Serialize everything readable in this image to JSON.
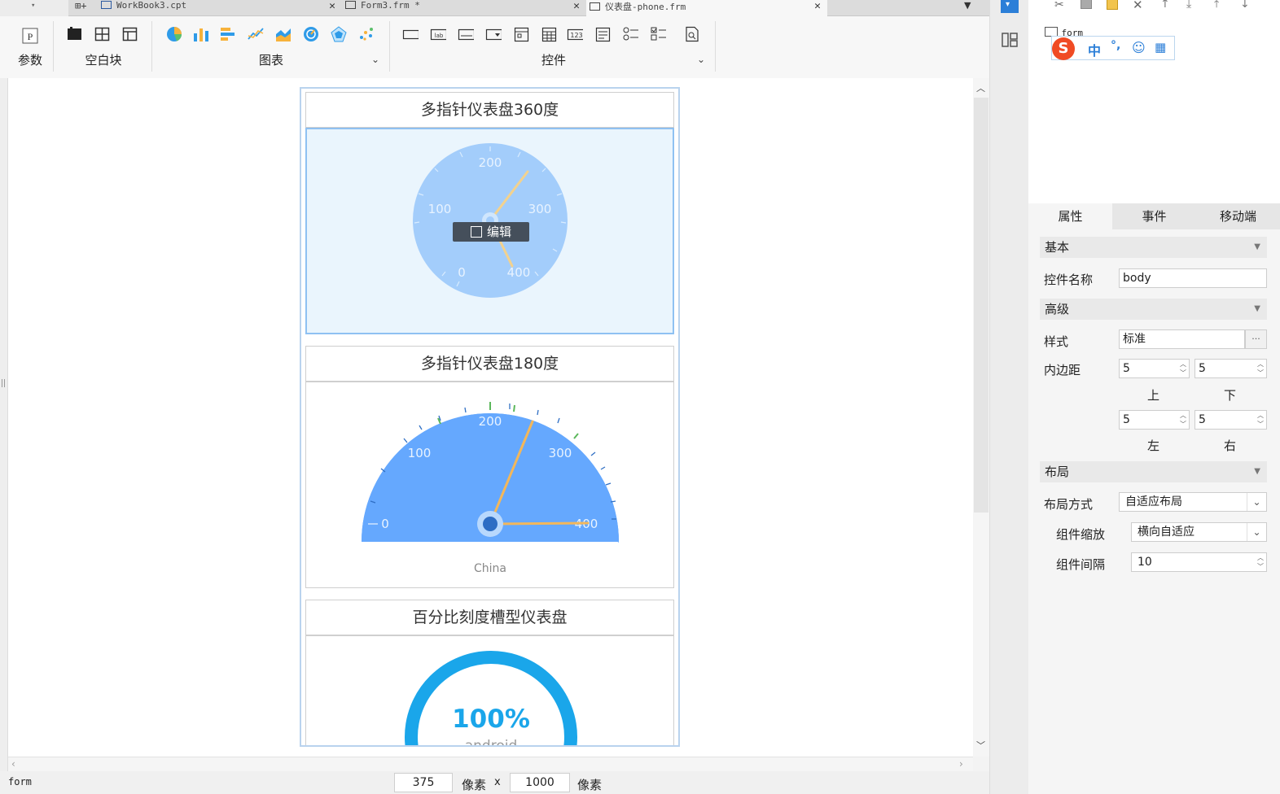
{
  "tabs": [
    {
      "label": "WorkBook3.cpt",
      "icon": "workbook-icon"
    },
    {
      "label": "Form3.frm *",
      "icon": "form-icon"
    },
    {
      "label": "仪表盘-phone.frm",
      "icon": "form-icon"
    }
  ],
  "toolbar": {
    "groups": [
      {
        "label": "参数"
      },
      {
        "label": "空白块"
      },
      {
        "label": "图表"
      },
      {
        "label": "控件"
      }
    ]
  },
  "canvas": {
    "widgets": [
      {
        "title": "多指针仪表盘360度",
        "ticks": [
          "200",
          "100",
          "300",
          "0",
          "400"
        ],
        "edit_label": "编辑"
      },
      {
        "title": "多指针仪表盘180度",
        "ticks": [
          "200",
          "100",
          "300",
          "0",
          "400"
        ],
        "footer": "China"
      },
      {
        "title": "百分比刻度槽型仪表盘",
        "value": "100%",
        "footer": "android"
      }
    ]
  },
  "statusbar": {
    "name": "form",
    "width": "375",
    "unit1": "像素",
    "times": "x",
    "height": "1000",
    "unit2": "像素"
  },
  "right": {
    "tree_root": "form",
    "tabs": [
      "属性",
      "事件",
      "移动端"
    ],
    "sections": {
      "basic": "基本",
      "advanced": "高级",
      "layout": "布局"
    },
    "widget_name_label": "控件名称",
    "widget_name_value": "body",
    "style_label": "样式",
    "style_value": "标准",
    "style_more": "···",
    "padding_label": "内边距",
    "padding": {
      "top": "5",
      "bottom": "5",
      "left": "5",
      "right": "5"
    },
    "padding_sub": {
      "top": "上",
      "bottom": "下",
      "left": "左",
      "right": "右"
    },
    "layout_mode_label": "布局方式",
    "layout_mode_value": "自适应布局",
    "scale_label": "组件缩放",
    "scale_value": "横向自适应",
    "gap_label": "组件间隔",
    "gap_value": "10"
  },
  "ime": {
    "lang": "中",
    "punct": "°,"
  },
  "colors": {
    "gauge360": "#a3cdfb",
    "gauge180": "#65a8fe",
    "pointer": "#f3b75a",
    "ring": "#1aa6ea",
    "accent_blue": "#2c7fd8"
  }
}
